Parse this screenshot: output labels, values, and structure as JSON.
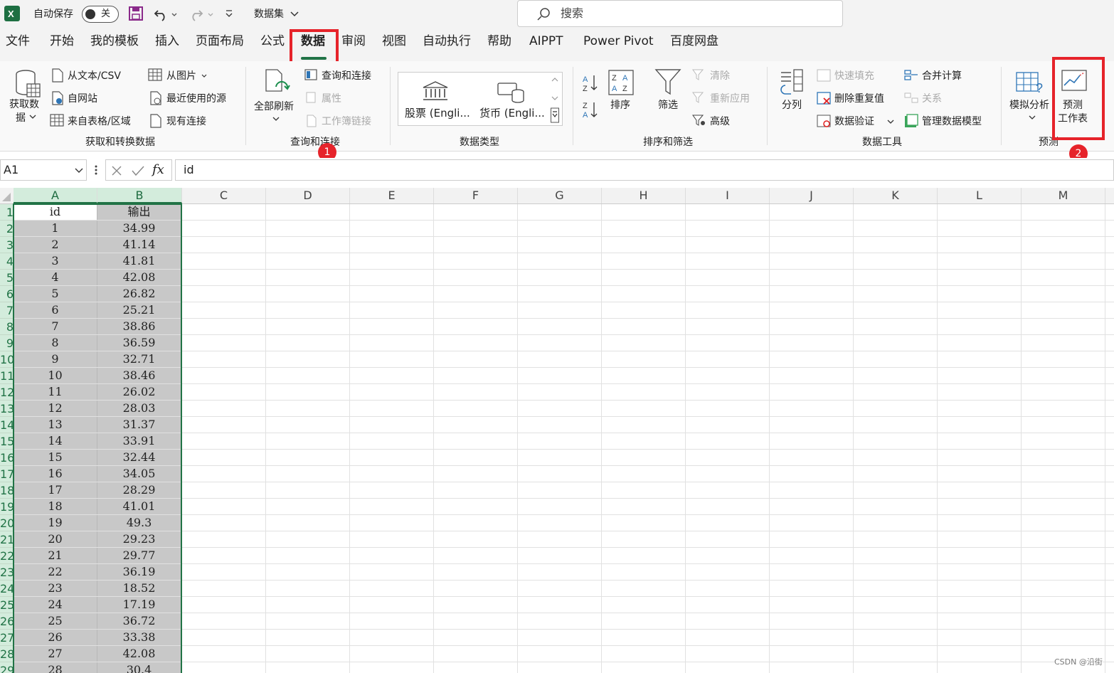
{
  "titlebar": {
    "autosave_label": "自动保存",
    "autosave_state": "关",
    "filename": "数据集",
    "search_placeholder": "搜索",
    "icons": [
      "excel-logo-icon",
      "save-icon",
      "undo-icon",
      "redo-icon",
      "customize-icon"
    ]
  },
  "menu": {
    "items": [
      "文件",
      "开始",
      "我的模板",
      "插入",
      "页面布局",
      "公式",
      "数据",
      "审阅",
      "视图",
      "自动执行",
      "帮助",
      "AIPPT",
      "Power Pivot",
      "百度网盘"
    ],
    "active": "数据"
  },
  "ribbon": {
    "get_data": "获取数",
    "get_data2": "据",
    "from_text": "从文本/CSV",
    "from_web": "自网站",
    "from_table": "来自表格/区域",
    "from_picture": "从图片",
    "recent_sources": "最近使用的源",
    "existing_conn": "现有连接",
    "group_get": "获取和转换数据",
    "refresh_all": "全部刷新",
    "queries_conn": "查询和连接",
    "properties": "属性",
    "workbook_links": "工作簿链接",
    "group_query": "查询和连接",
    "stocks": "股票 (Engli...",
    "currency": "货币 (Engli...",
    "group_types": "数据类型",
    "sort": "排序",
    "filter": "筛选",
    "clear": "清除",
    "reapply": "重新应用",
    "advanced": "高级",
    "group_sort": "排序和筛选",
    "text_to_cols": "分列",
    "flash_fill": "快速填充",
    "remove_dup": "删除重复值",
    "data_valid": "数据验证",
    "consolidate": "合并计算",
    "relations": "关系",
    "manage_model": "管理数据模型",
    "group_tools": "数据工具",
    "whatif": "模拟分析",
    "forecast_sheet_1": "预测",
    "forecast_sheet_2": "工作表",
    "group_forecast": "预测"
  },
  "annotations": {
    "badge1": "1",
    "badge2": "2"
  },
  "formula": {
    "name_box": "A1",
    "content": "id",
    "fx": "fx"
  },
  "columns": [
    "A",
    "B",
    "C",
    "D",
    "E",
    "F",
    "G",
    "H",
    "I",
    "J",
    "K",
    "L",
    "M"
  ],
  "rows": [
    {
      "n": "1",
      "a": "id",
      "b": "输出"
    },
    {
      "n": "2",
      "a": "1",
      "b": "34.99"
    },
    {
      "n": "3",
      "a": "2",
      "b": "41.14"
    },
    {
      "n": "4",
      "a": "3",
      "b": "41.81"
    },
    {
      "n": "5",
      "a": "4",
      "b": "42.08"
    },
    {
      "n": "6",
      "a": "5",
      "b": "26.82"
    },
    {
      "n": "7",
      "a": "6",
      "b": "25.21"
    },
    {
      "n": "8",
      "a": "7",
      "b": "38.86"
    },
    {
      "n": "9",
      "a": "8",
      "b": "36.59"
    },
    {
      "n": "10",
      "a": "9",
      "b": "32.71"
    },
    {
      "n": "11",
      "a": "10",
      "b": "38.46"
    },
    {
      "n": "12",
      "a": "11",
      "b": "26.02"
    },
    {
      "n": "13",
      "a": "12",
      "b": "28.03"
    },
    {
      "n": "14",
      "a": "13",
      "b": "31.37"
    },
    {
      "n": "15",
      "a": "14",
      "b": "33.91"
    },
    {
      "n": "16",
      "a": "15",
      "b": "32.44"
    },
    {
      "n": "17",
      "a": "16",
      "b": "34.05"
    },
    {
      "n": "18",
      "a": "17",
      "b": "28.29"
    },
    {
      "n": "19",
      "a": "18",
      "b": "41.01"
    },
    {
      "n": "20",
      "a": "19",
      "b": "49.3"
    },
    {
      "n": "21",
      "a": "20",
      "b": "29.23"
    },
    {
      "n": "22",
      "a": "21",
      "b": "29.77"
    },
    {
      "n": "23",
      "a": "22",
      "b": "36.19"
    },
    {
      "n": "24",
      "a": "23",
      "b": "18.52"
    },
    {
      "n": "25",
      "a": "24",
      "b": "17.19"
    },
    {
      "n": "26",
      "a": "25",
      "b": "36.72"
    },
    {
      "n": "27",
      "a": "26",
      "b": "33.38"
    },
    {
      "n": "28",
      "a": "27",
      "b": "42.08"
    },
    {
      "n": "29",
      "a": "28",
      "b": "30.4"
    }
  ],
  "watermark": "CSDN @沿街",
  "colors": {
    "accent": "#217346",
    "highlight": "#e6232a",
    "selection": "#c8c8c8"
  }
}
